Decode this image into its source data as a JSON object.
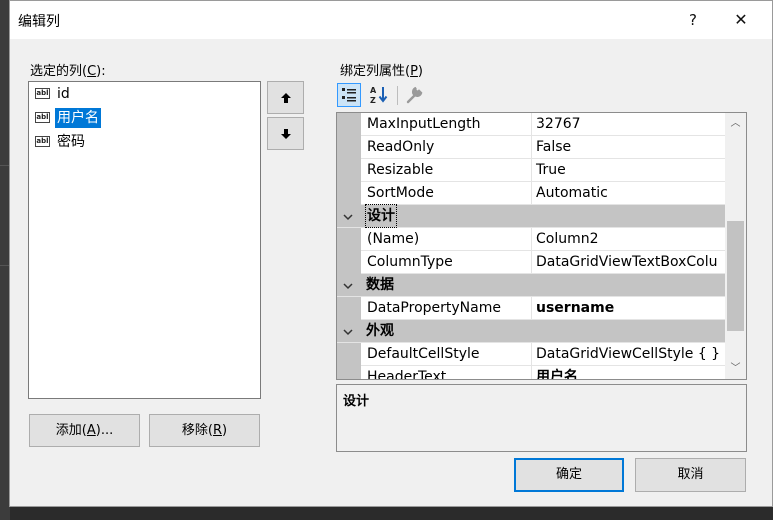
{
  "window": {
    "title": "编辑列",
    "help_label": "?",
    "close_label": "✕"
  },
  "left": {
    "label_prefix": "选定的列(",
    "label_key": "C",
    "label_suffix": "):",
    "items": [
      {
        "text": "id",
        "selected": false
      },
      {
        "text": "用户名",
        "selected": true
      },
      {
        "text": "密码",
        "selected": false
      }
    ],
    "item_icon": "abl",
    "up_label": "🡅",
    "down_label": "🡇",
    "add_prefix": "添加(",
    "add_key": "A",
    "add_suffix": ")...",
    "remove_prefix": "移除(",
    "remove_key": "R",
    "remove_suffix": ")"
  },
  "right": {
    "label_prefix": "绑定列属性(",
    "label_key": "P",
    "label_suffix": ")",
    "rows": [
      {
        "type": "prop",
        "name": "MaxInputLength",
        "value": "32767",
        "bold": false
      },
      {
        "type": "prop",
        "name": "ReadOnly",
        "value": "False",
        "bold": false
      },
      {
        "type": "prop",
        "name": "Resizable",
        "value": "True",
        "bold": false
      },
      {
        "type": "prop",
        "name": "SortMode",
        "value": "Automatic",
        "bold": false
      },
      {
        "type": "category",
        "name": "设计"
      },
      {
        "type": "prop",
        "name": "(Name)",
        "value": "Column2",
        "bold": false
      },
      {
        "type": "prop",
        "name": "ColumnType",
        "value": "DataGridViewTextBoxColu",
        "bold": false
      },
      {
        "type": "category",
        "name": "数据"
      },
      {
        "type": "prop",
        "name": "DataPropertyName",
        "value": "username",
        "bold": true
      },
      {
        "type": "category",
        "name": "外观"
      },
      {
        "type": "prop",
        "name": "DefaultCellStyle",
        "value": "DataGridViewCellStyle { }",
        "bold": false
      },
      {
        "type": "prop",
        "name": "HeaderText",
        "value": "用户名",
        "bold": true
      }
    ],
    "description_title": "设计"
  },
  "footer": {
    "ok_label": "确定",
    "cancel_label": "取消"
  },
  "colors": {
    "selection": "#0078d7",
    "category_band": "#c4c4c4",
    "dialog_bg": "#f0f0f0"
  }
}
